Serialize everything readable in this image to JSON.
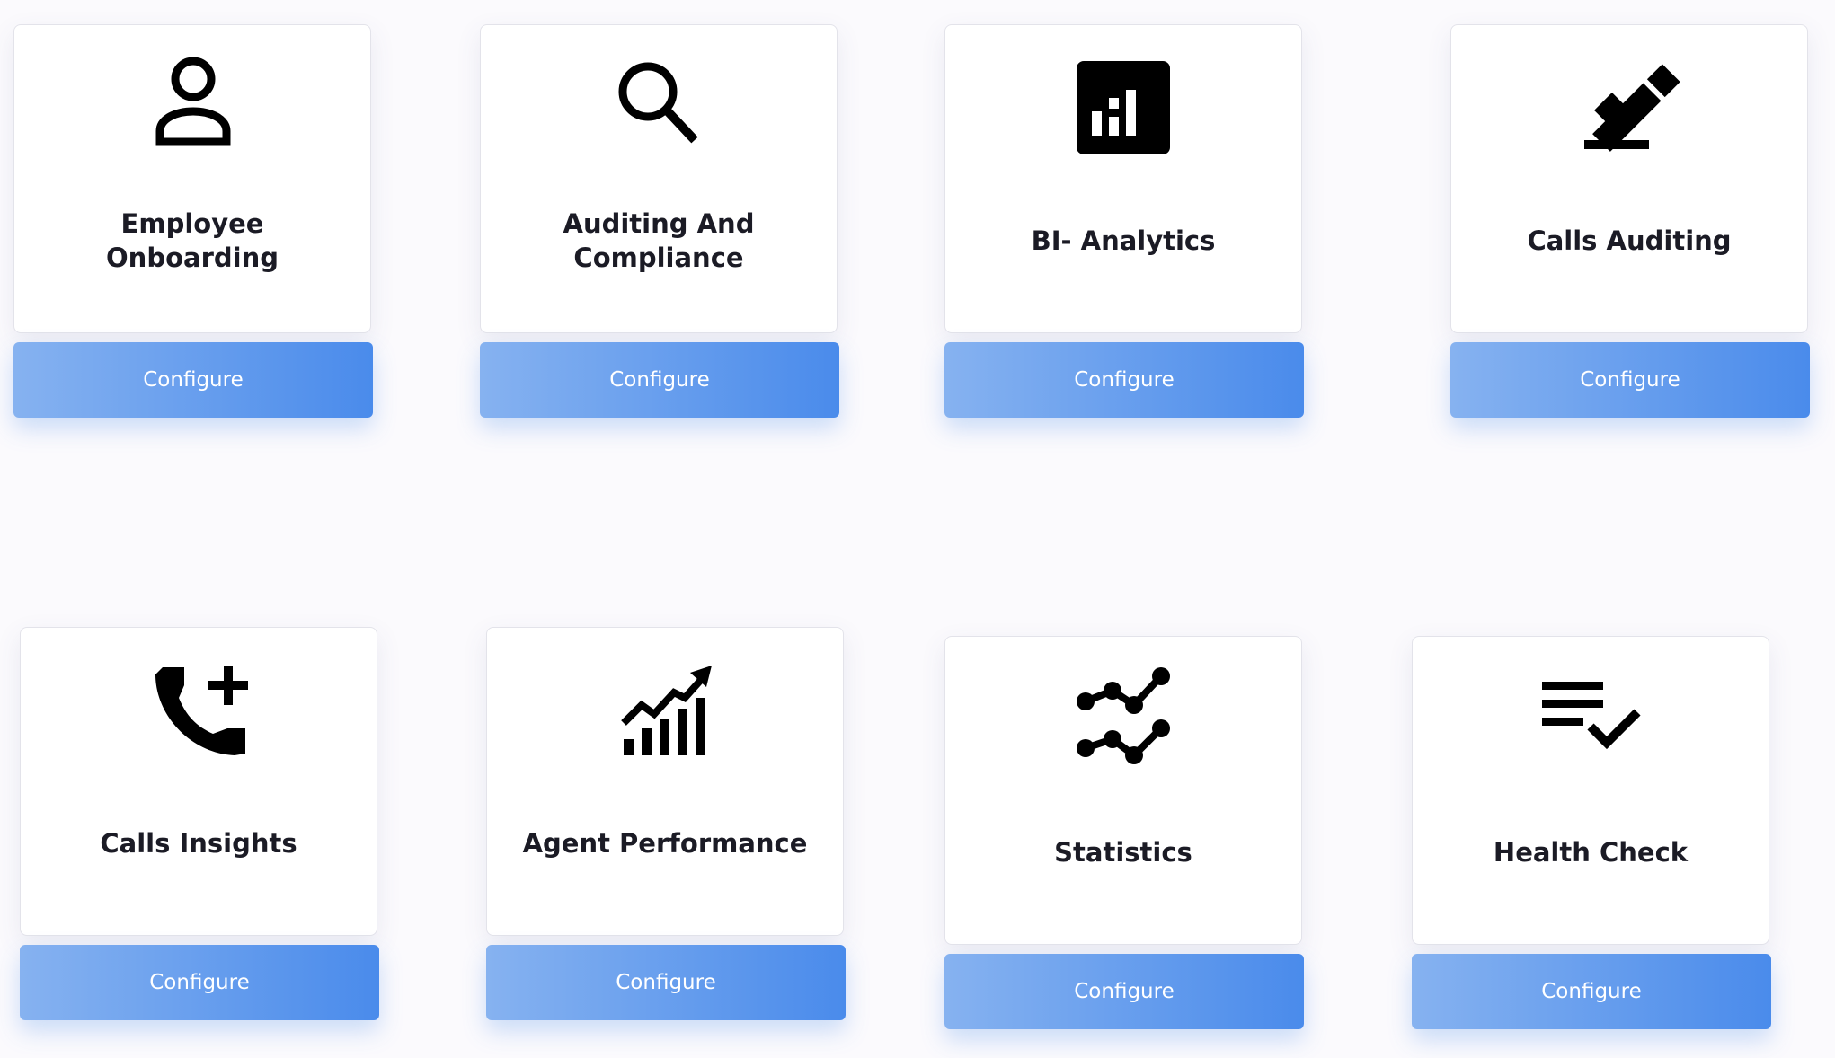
{
  "modules": [
    {
      "title": "Employee Onboarding",
      "icon": "person-icon",
      "button_label": "Configure"
    },
    {
      "title": "Auditing And Compliance",
      "icon": "search-icon",
      "button_label": "Configure"
    },
    {
      "title": "BI- Analytics",
      "icon": "bar-chart-icon",
      "button_label": "Configure"
    },
    {
      "title": "Calls Auditing",
      "icon": "gavel-icon",
      "button_label": "Configure"
    },
    {
      "title": "Calls Insights",
      "icon": "add-call-icon",
      "button_label": "Configure"
    },
    {
      "title": "Agent Performance",
      "icon": "trending-up-chart-icon",
      "button_label": "Configure"
    },
    {
      "title": "Statistics",
      "icon": "multiline-chart-icon",
      "button_label": "Configure"
    },
    {
      "title": "Health Check",
      "icon": "checklist-icon",
      "button_label": "Configure"
    }
  ],
  "colors": {
    "background": "#fbfafd",
    "card": "#ffffff",
    "button_gradient_start": "#86b2f0",
    "button_gradient_end": "#4a8beb",
    "title_text": "#1b1b25",
    "icon": "#000000"
  }
}
